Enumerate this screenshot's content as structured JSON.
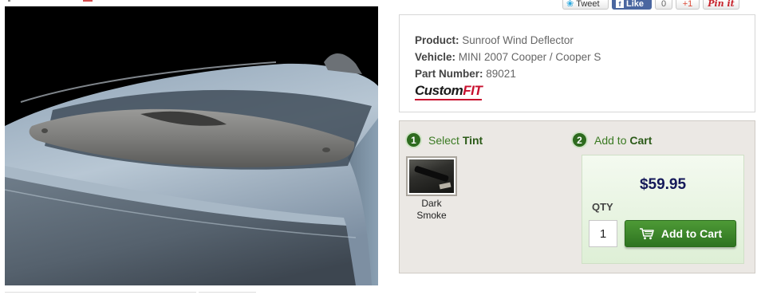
{
  "social": {
    "tweet_label": "Tweet",
    "like_label": "Like",
    "like_count": "0",
    "gplus_label": "+1",
    "pin_label": "Pin it"
  },
  "product_image_alt": "Sunroof Wind Deflector on MINI Cooper",
  "info": {
    "product_label": "Product:",
    "product_value": "Sunroof Wind Deflector",
    "vehicle_label": "Vehicle:",
    "vehicle_value": "MINI 2007 Cooper / Cooper S",
    "part_label": "Part Number:",
    "part_value": "89021",
    "logo_custom": "Custom",
    "logo_fit": "FIT"
  },
  "steps": {
    "step1_number": "1",
    "step1_prefix": "Select",
    "step1_bold": "Tint",
    "step2_number": "2",
    "step2_prefix": "Add to",
    "step2_bold": "Cart"
  },
  "tint": {
    "option_label_line1": "Dark",
    "option_label_line2": "Smoke"
  },
  "cart": {
    "price": "$59.95",
    "qty_label": "QTY",
    "qty_value": "1",
    "add_button_label": "Add to Cart"
  },
  "colors": {
    "accent_green": "#2e7320",
    "price_navy": "#15195a",
    "panel_bg": "#ebe8e4",
    "logo_red": "#c8102e"
  },
  "icons": [
    "twitter-bird-icon",
    "facebook-f-icon",
    "cart-icon",
    "step-number-badge"
  ]
}
